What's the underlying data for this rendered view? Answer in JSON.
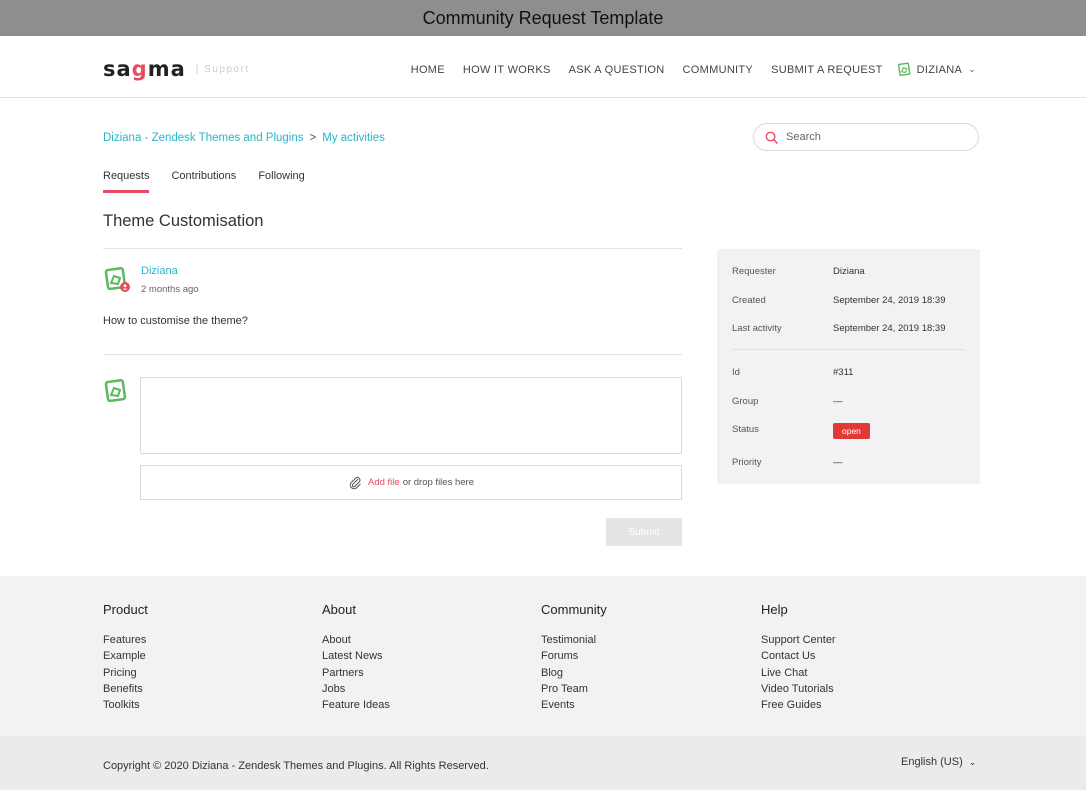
{
  "window": {
    "title": "Community Request Template"
  },
  "header": {
    "logo_text_a": "sa",
    "logo_text_b": "g",
    "logo_text_c": "ma",
    "logo_sub": "| Support",
    "nav": [
      "HOME",
      "HOW IT WORKS",
      "ASK A QUESTION",
      "COMMUNITY",
      "SUBMIT A REQUEST"
    ],
    "user": "DIZIANA"
  },
  "breadcrumb": {
    "root": "Diziana - Zendesk Themes and Plugins",
    "separator": ">",
    "current": "My activities"
  },
  "search": {
    "placeholder": "Search",
    "value": ""
  },
  "tabs": [
    {
      "label": "Requests",
      "active": true
    },
    {
      "label": "Contributions",
      "active": false
    },
    {
      "label": "Following",
      "active": false
    }
  ],
  "request": {
    "title": "Theme Customisation",
    "comment": {
      "author": "Diziana",
      "time": "2 months ago",
      "body": "How to customise the theme?"
    },
    "reply_value": "",
    "attach": {
      "link": "Add file",
      "text": "or drop files here"
    },
    "submit_label": "Submit"
  },
  "details": {
    "requester_label": "Requester",
    "requester": "Diziana",
    "created_label": "Created",
    "created": "September 24, 2019 18:39",
    "last_activity_label": "Last activity",
    "last_activity": "September 24, 2019 18:39",
    "id_label": "Id",
    "id": "#311",
    "group_label": "Group",
    "group": "—",
    "status_label": "Status",
    "status": "open",
    "priority_label": "Priority",
    "priority": "—"
  },
  "footer": {
    "columns": [
      {
        "heading": "Product",
        "links": [
          "Features",
          "Example",
          "Pricing",
          "Benefits",
          "Toolkits"
        ]
      },
      {
        "heading": "About",
        "links": [
          "About",
          "Latest News",
          "Partners",
          "Jobs",
          "Feature Ideas"
        ]
      },
      {
        "heading": "Community",
        "links": [
          "Testimonial",
          "Forums",
          "Blog",
          "Pro Team",
          "Events"
        ]
      },
      {
        "heading": "Help",
        "links": [
          "Support Center",
          "Contact Us",
          "Live Chat",
          "Video Tutorials",
          "Free Guides"
        ]
      }
    ],
    "copyright": "Copyright © 2020 Diziana - Zendesk Themes and Plugins. All Rights Reserved.",
    "language": "English (US)"
  },
  "colors": {
    "accent": "#e84c5f",
    "link": "#2ab5c9",
    "status_open": "#e13838"
  }
}
